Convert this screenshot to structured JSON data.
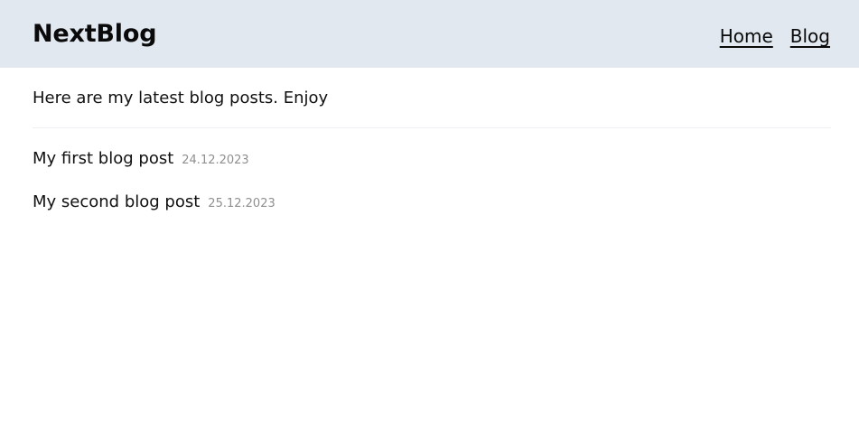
{
  "header": {
    "brand": "NextBlog",
    "nav": [
      {
        "label": "Home"
      },
      {
        "label": "Blog"
      }
    ]
  },
  "main": {
    "intro": "Here are my latest blog posts. Enjoy",
    "posts": [
      {
        "title": "My first blog post",
        "date": "24.12.2023"
      },
      {
        "title": "My second blog post",
        "date": "25.12.2023"
      }
    ]
  },
  "colors": {
    "header_bg": "#e2e8f0",
    "text": "#111111",
    "date_text": "#8f8f8f"
  }
}
